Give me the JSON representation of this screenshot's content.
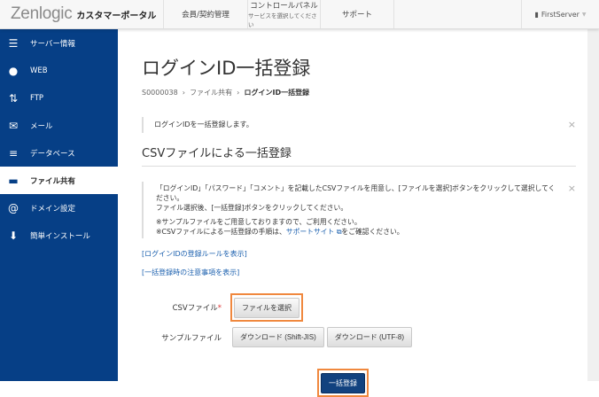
{
  "header": {
    "logo": "Zenlogic",
    "portal": "カスタマーポータル",
    "nav": [
      {
        "label": "会員/契約管理"
      },
      {
        "label": "コントロールパネル",
        "sub": "サービスを選択してください"
      },
      {
        "label": "サポート"
      }
    ],
    "user": "FirstServer"
  },
  "sidebar": {
    "items": [
      {
        "label": "サーバー情報",
        "icon": "server-icon"
      },
      {
        "label": "WEB",
        "icon": "globe-icon"
      },
      {
        "label": "FTP",
        "icon": "transfer-icon"
      },
      {
        "label": "メール",
        "icon": "mail-icon"
      },
      {
        "label": "データベース",
        "icon": "database-icon"
      },
      {
        "label": "ファイル共有",
        "icon": "folder-icon",
        "active": true
      },
      {
        "label": "ドメイン設定",
        "icon": "at-icon"
      },
      {
        "label": "簡単インストール",
        "icon": "install-icon"
      }
    ]
  },
  "page": {
    "title": "ログインID一括登録",
    "breadcrumb": [
      "S0000038",
      "ファイル共有",
      "ログインID一括登録"
    ],
    "alert": "ログインIDを一括登録します。",
    "section": "CSVファイルによる一括登録",
    "info": [
      "「ログインID」「パスワード」「コメント」を記載したCSVファイルを用意し、[ファイルを選択]ボタンをクリックして選択してください。",
      "ファイル選択後、[一括登録]ボタンをクリックしてください。",
      "※サンプルファイルをご用意しておりますので、ご利用ください。",
      "※CSVファイルによる一括登録の手順は、",
      "サポートサイト",
      "をご確認ください。"
    ],
    "links": [
      "[ログインIDの登録ルールを表示]",
      "[一括登録時の注意事項を表示]"
    ],
    "csv_label": "CSVファイル",
    "required": "*",
    "choose_file": "ファイルを選択",
    "sample_label": "サンプルファイル",
    "dl_sjis": "ダウンロード (Shift-JIS)",
    "dl_utf8": "ダウンロード (UTF-8)",
    "submit": "一括登録"
  },
  "colors": {
    "sidebar": "#063f86",
    "highlight": "#f0883e",
    "primary": "#12427f"
  }
}
